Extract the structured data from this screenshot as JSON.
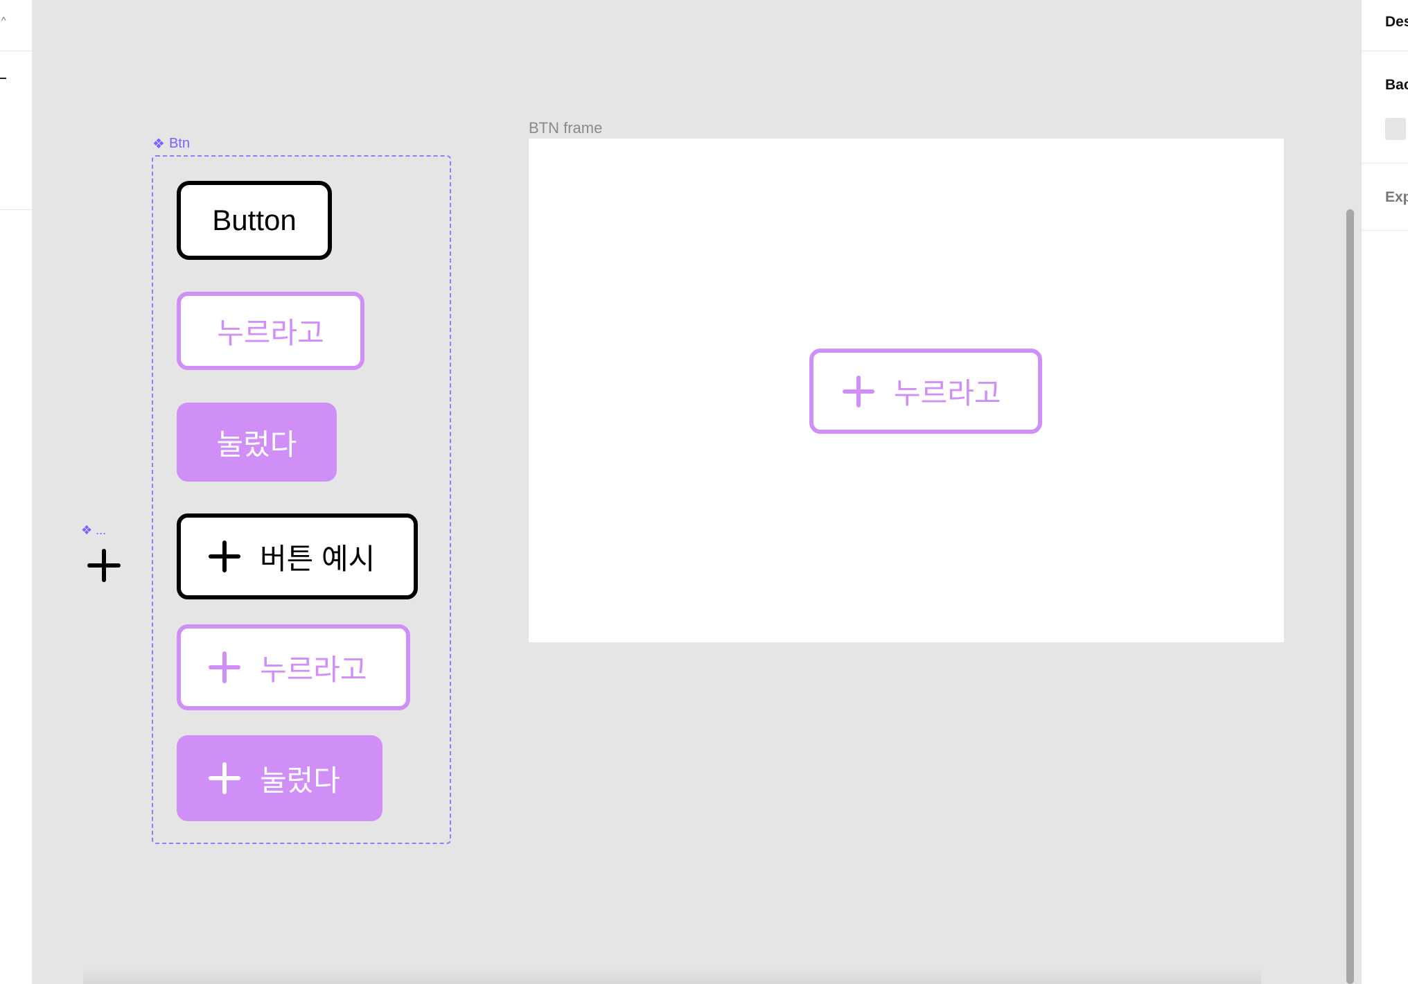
{
  "left_panel": {
    "chevron_icon": "chevron-up-icon",
    "minus_icon": "minus-icon"
  },
  "canvas": {
    "component_set": {
      "label": "Btn",
      "icon": "component-set-icon",
      "buttons": [
        {
          "label": "Button",
          "variant": "black",
          "icon": null
        },
        {
          "label": "누르라고",
          "variant": "outline",
          "icon": null
        },
        {
          "label": "눌렀다",
          "variant": "filled",
          "icon": null
        },
        {
          "label": "버튼 예시",
          "variant": "black",
          "icon": "plus-icon"
        },
        {
          "label": "누르라고",
          "variant": "outline",
          "icon": "plus-icon"
        },
        {
          "label": "눌렀다",
          "variant": "filled",
          "icon": "plus-icon"
        }
      ]
    },
    "instance": {
      "label": "❖ ...",
      "icon": "plus-icon"
    },
    "frame": {
      "label": "BTN frame",
      "button": {
        "label": "누르라고",
        "variant": "outline",
        "icon": "plus-icon"
      }
    }
  },
  "right_panel": {
    "design_tab": "Des",
    "background_label": "Bac",
    "export_label": "Exp"
  },
  "colors": {
    "canvas_bg": "#e5e5e5",
    "component_purple": "#7b61ff",
    "button_purple": "#cf8ff7",
    "black": "#000000",
    "frame_bg": "#ffffff"
  }
}
